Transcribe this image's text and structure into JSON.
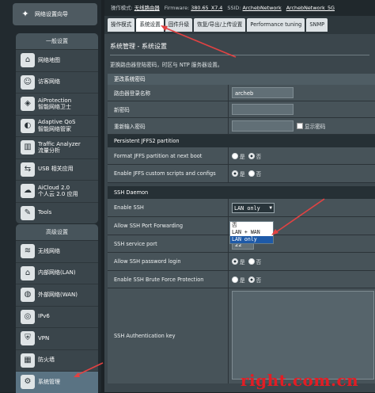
{
  "accent_color": "#e24242",
  "sidebar": {
    "quick_setup": {
      "label": "网络设置向导",
      "icon": "magic-wand-icon"
    },
    "general_title": "一般设置",
    "general_items": [
      {
        "label": "网络地图",
        "icon": "network-map-icon"
      },
      {
        "label": "访客网络",
        "icon": "guest-network-icon"
      },
      {
        "label": "AiProtection",
        "sub": "智能网络卫士",
        "icon": "shield-icon"
      },
      {
        "label": "Adaptive QoS",
        "sub": "智能网络管家",
        "icon": "qos-icon"
      },
      {
        "label": "Traffic Analyzer",
        "sub": "流量分析",
        "icon": "chart-icon"
      },
      {
        "label": "USB 相关应用",
        "icon": "usb-icon"
      },
      {
        "label": "AiCloud 2.0",
        "sub": "个人云 2.0 应用",
        "icon": "cloud-icon"
      },
      {
        "label": "Tools",
        "icon": "wrench-icon"
      }
    ],
    "advanced_title": "高级设置",
    "advanced_items": [
      {
        "label": "无线网络",
        "icon": "wifi-icon"
      },
      {
        "label": "内部网络(LAN)",
        "icon": "home-icon"
      },
      {
        "label": "外部网络(WAN)",
        "icon": "globe-icon"
      },
      {
        "label": "IPv6",
        "icon": "ipv6-icon"
      },
      {
        "label": "VPN",
        "icon": "vpn-icon"
      },
      {
        "label": "防火墙",
        "icon": "firewall-icon"
      },
      {
        "label": "系统管理",
        "icon": "admin-icon",
        "selected": true
      }
    ]
  },
  "topbar": {
    "mode_label": "操作模式:",
    "mode_value": "无线路由器",
    "fw_label": "Firmware:",
    "fw_value": "380.65_X7.4",
    "ssid_label": "SSID:",
    "ssid_1": "ArchebNetwork",
    "ssid_2": "ArchebNetwork_5G"
  },
  "tabs": [
    {
      "label": "操作模式"
    },
    {
      "label": "系统设置",
      "active": true
    },
    {
      "label": "固件升级"
    },
    {
      "label": "恢复/导出/上传设置"
    },
    {
      "label": "Performance tuning"
    },
    {
      "label": "SNMP"
    }
  ],
  "page": {
    "title": "系统管理 - 系统设置",
    "description": "更换路由器登陆密码，时区与 NTP 服务器设置。"
  },
  "password_section": {
    "title": "更改系统密码",
    "username_label": "路由器登录名称",
    "username_value": "archeb",
    "new_password_label": "新密码",
    "confirm_password_label": "重新输入密码",
    "show_password_label": "显示密码"
  },
  "jffs_section": {
    "title": "Persistent JFFS2 partition",
    "format_label": "Format JFFS partition at next boot",
    "scripts_label": "Enable JFFS custom scripts and configs",
    "yes": "是",
    "no": "否"
  },
  "ssh_section": {
    "title": "SSH Daemon",
    "enable_label": "Enable SSH",
    "enable_value": "LAN only",
    "options": [
      "否",
      "LAN + WAN",
      "LAN only"
    ],
    "highlighted_option": "LAN only",
    "forwarding_label": "Allow SSH Port Forwarding",
    "port_label": "SSH service port",
    "port_value": "22",
    "password_login_label": "Allow SSH password login",
    "brute_force_label": "Enable SSH Brute Force Protection",
    "auth_key_label": "SSH Authentication key",
    "yes": "是",
    "no": "否"
  },
  "watermark": "right.com.cn"
}
